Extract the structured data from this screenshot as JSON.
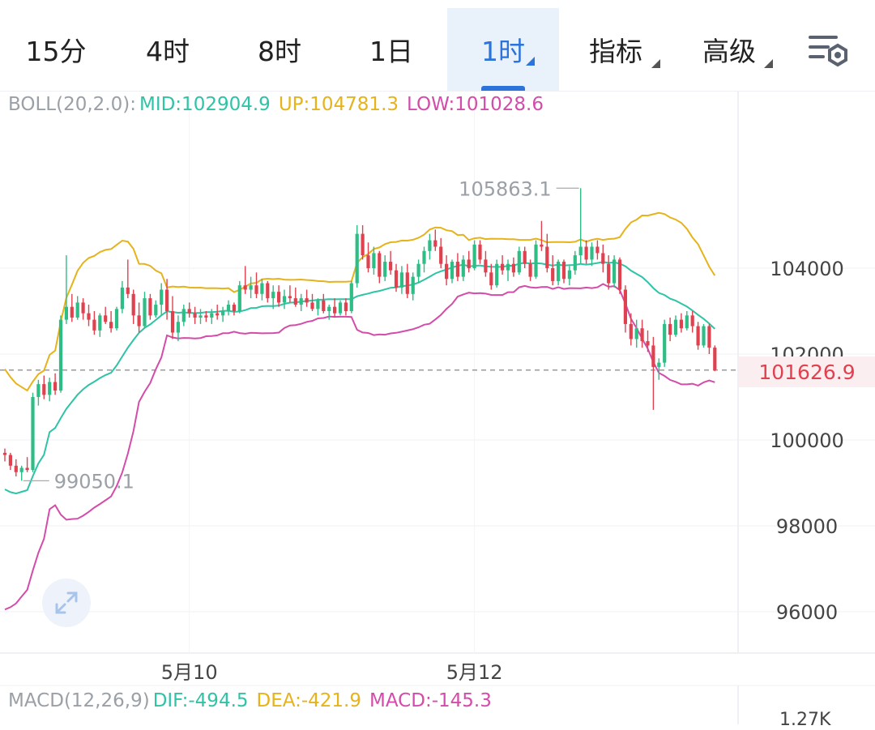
{
  "tabs": [
    {
      "label": "15分",
      "active": false,
      "dropdown": false
    },
    {
      "label": "4时",
      "active": false,
      "dropdown": false
    },
    {
      "label": "8时",
      "active": false,
      "dropdown": false
    },
    {
      "label": "1日",
      "active": false,
      "dropdown": false
    },
    {
      "label": "1时",
      "active": true,
      "dropdown": true
    },
    {
      "label": "指标",
      "active": false,
      "dropdown": true
    },
    {
      "label": "高级",
      "active": false,
      "dropdown": true
    }
  ],
  "settings_icon": "chart-settings-icon",
  "boll": {
    "label": "BOLL(20,2.0):",
    "mid": "MID:102904.9",
    "up": "UP:104781.3",
    "low": "LOW:101028.6"
  },
  "current_price": "101626.9",
  "macd": {
    "label": "MACD(12,26,9)",
    "dif": "DIF:-494.5",
    "dea": "DEA:-421.9",
    "macd": "MACD:-145.3",
    "axis_label": "1.27K"
  },
  "colors": {
    "up": "#2ebd85",
    "down": "#e0414f",
    "mid": "#2fc3a7",
    "upper": "#e6b31b",
    "lower": "#d44caa",
    "accent": "#2c73da"
  },
  "chart_data": {
    "type": "candlestick",
    "y_ticks": [
      104000,
      102000,
      100000,
      98000,
      96000
    ],
    "ylim": [
      95500,
      106500
    ],
    "x_ticks": [
      "5月10",
      "5月12"
    ],
    "high_marker": "105863.1",
    "low_marker": "99050.1",
    "last_price": 101626.9,
    "candles": [
      [
        99700,
        99800,
        99500,
        99650
      ],
      [
        99650,
        99700,
        99300,
        99400
      ],
      [
        99400,
        99550,
        99150,
        99250
      ],
      [
        99250,
        99400,
        99050,
        99350
      ],
      [
        99350,
        99600,
        99250,
        99300
      ],
      [
        99300,
        101100,
        99250,
        101000
      ],
      [
        101000,
        101400,
        100800,
        101300
      ],
      [
        101300,
        101500,
        100950,
        101050
      ],
      [
        101050,
        101450,
        100900,
        101350
      ],
      [
        101350,
        101550,
        101050,
        101150
      ],
      [
        101150,
        102900,
        101100,
        102800
      ],
      [
        102800,
        104300,
        102700,
        103100
      ],
      [
        103100,
        103400,
        102750,
        102850
      ],
      [
        102850,
        103350,
        102800,
        103200
      ],
      [
        103200,
        103300,
        102800,
        102950
      ],
      [
        102950,
        103150,
        102650,
        102800
      ],
      [
        102800,
        103000,
        102450,
        102550
      ],
      [
        102550,
        102950,
        102400,
        102900
      ],
      [
        102900,
        103100,
        102700,
        102750
      ],
      [
        102750,
        103000,
        102500,
        102600
      ],
      [
        102600,
        103100,
        102550,
        103050
      ],
      [
        103050,
        103700,
        102950,
        103550
      ],
      [
        103550,
        104200,
        103300,
        103400
      ],
      [
        103400,
        103500,
        102700,
        102900
      ],
      [
        102900,
        103200,
        102500,
        102650
      ],
      [
        102650,
        103450,
        102600,
        103300
      ],
      [
        103300,
        103400,
        102800,
        102900
      ],
      [
        102900,
        103250,
        102850,
        103150
      ],
      [
        103150,
        103650,
        102900,
        103500
      ],
      [
        103500,
        103750,
        102800,
        103000
      ],
      [
        103000,
        103350,
        102350,
        102500
      ],
      [
        102500,
        102900,
        102300,
        102750
      ],
      [
        102750,
        103150,
        102650,
        103050
      ],
      [
        103050,
        103200,
        102850,
        102950
      ],
      [
        102950,
        103100,
        102700,
        102850
      ],
      [
        102850,
        103050,
        102700,
        102900
      ],
      [
        102900,
        103000,
        102750,
        102850
      ],
      [
        102850,
        103050,
        102700,
        102950
      ],
      [
        102950,
        103150,
        102800,
        102900
      ],
      [
        102900,
        103100,
        102750,
        103000
      ],
      [
        103000,
        103250,
        102900,
        103150
      ],
      [
        103150,
        103200,
        102900,
        103000
      ],
      [
        103000,
        103700,
        102950,
        103600
      ],
      [
        103600,
        104050,
        103400,
        103500
      ],
      [
        103500,
        103800,
        103300,
        103600
      ],
      [
        103600,
        103900,
        103300,
        103400
      ],
      [
        103400,
        103750,
        103250,
        103650
      ],
      [
        103650,
        103700,
        103200,
        103300
      ],
      [
        103300,
        103600,
        103050,
        103450
      ],
      [
        103450,
        103600,
        103100,
        103200
      ],
      [
        103200,
        103500,
        103050,
        103350
      ],
      [
        103350,
        103600,
        103200,
        103300
      ],
      [
        103300,
        103550,
        103100,
        103150
      ],
      [
        103150,
        103400,
        103000,
        103300
      ],
      [
        103300,
        103500,
        103100,
        103200
      ],
      [
        103200,
        103400,
        103000,
        103050
      ],
      [
        103050,
        103300,
        102900,
        103250
      ],
      [
        103250,
        103400,
        102950,
        103000
      ],
      [
        103000,
        103150,
        102800,
        103100
      ],
      [
        103100,
        103300,
        102850,
        102950
      ],
      [
        102950,
        103250,
        102900,
        103200
      ],
      [
        103200,
        103300,
        102900,
        103000
      ],
      [
        103000,
        103700,
        102950,
        103650
      ],
      [
        103650,
        105000,
        103550,
        104800
      ],
      [
        104800,
        105000,
        104200,
        104300
      ],
      [
        104300,
        104600,
        103900,
        104000
      ],
      [
        104000,
        104500,
        103850,
        104350
      ],
      [
        104350,
        104400,
        103650,
        103800
      ],
      [
        103800,
        104300,
        103700,
        104150
      ],
      [
        104150,
        104400,
        103850,
        103950
      ],
      [
        103950,
        104100,
        103450,
        103550
      ],
      [
        103550,
        104050,
        103400,
        103900
      ],
      [
        103900,
        104100,
        103300,
        103400
      ],
      [
        103400,
        103900,
        103250,
        103800
      ],
      [
        103800,
        104200,
        103650,
        104100
      ],
      [
        104100,
        104500,
        103900,
        104400
      ],
      [
        104400,
        104800,
        104200,
        104650
      ],
      [
        104650,
        104900,
        104400,
        104500
      ],
      [
        104500,
        104700,
        104000,
        104100
      ],
      [
        104100,
        104300,
        103600,
        103750
      ],
      [
        103750,
        104200,
        103650,
        104150
      ],
      [
        104150,
        104350,
        103700,
        103800
      ],
      [
        103800,
        104300,
        103700,
        104200
      ],
      [
        104200,
        104400,
        103900,
        104000
      ],
      [
        104000,
        104650,
        103950,
        104550
      ],
      [
        104550,
        104650,
        104100,
        104200
      ],
      [
        104200,
        104400,
        103800,
        103900
      ],
      [
        103900,
        104100,
        103500,
        103600
      ],
      [
        103600,
        104200,
        103550,
        104100
      ],
      [
        104100,
        104300,
        103850,
        103950
      ],
      [
        103950,
        104200,
        103700,
        104100
      ],
      [
        104100,
        104250,
        103800,
        103900
      ],
      [
        103900,
        104500,
        103850,
        104400
      ],
      [
        104400,
        104500,
        104000,
        104100
      ],
      [
        104100,
        104200,
        103700,
        103800
      ],
      [
        103800,
        104650,
        103750,
        104550
      ],
      [
        104550,
        105100,
        104400,
        104500
      ],
      [
        104500,
        104800,
        103900,
        104000
      ],
      [
        104000,
        104300,
        103600,
        103700
      ],
      [
        103700,
        104200,
        103600,
        104150
      ],
      [
        104150,
        104200,
        103650,
        103750
      ],
      [
        103750,
        104050,
        103600,
        103950
      ],
      [
        103950,
        104400,
        103850,
        104300
      ],
      [
        104300,
        105863.1,
        104100,
        104500
      ],
      [
        104500,
        104650,
        104100,
        104200
      ],
      [
        104200,
        104600,
        104050,
        104500
      ],
      [
        104500,
        104650,
        104200,
        104350
      ],
      [
        104350,
        104550,
        103900,
        104100
      ],
      [
        104100,
        104300,
        103500,
        103650
      ],
      [
        103650,
        104300,
        103550,
        104200
      ],
      [
        104200,
        104250,
        103400,
        103500
      ],
      [
        103500,
        103600,
        102500,
        102700
      ],
      [
        102700,
        102950,
        102200,
        102350
      ],
      [
        102350,
        102800,
        102150,
        102600
      ],
      [
        102600,
        102800,
        102150,
        102300
      ],
      [
        102300,
        102550,
        102050,
        102200
      ],
      [
        102200,
        102400,
        100700,
        101700
      ],
      [
        101700,
        101900,
        101400,
        101800
      ],
      [
        101800,
        102800,
        101700,
        102700
      ],
      [
        102700,
        102850,
        102300,
        102450
      ],
      [
        102450,
        102900,
        102400,
        102800
      ],
      [
        102800,
        102950,
        102500,
        102600
      ],
      [
        102600,
        103000,
        102550,
        102900
      ],
      [
        102900,
        103000,
        102500,
        102650
      ],
      [
        102650,
        102750,
        102100,
        102200
      ],
      [
        102200,
        102700,
        102150,
        102650
      ],
      [
        102650,
        102700,
        102000,
        102150
      ],
      [
        102150,
        102200,
        101600,
        101626.9
      ]
    ]
  }
}
